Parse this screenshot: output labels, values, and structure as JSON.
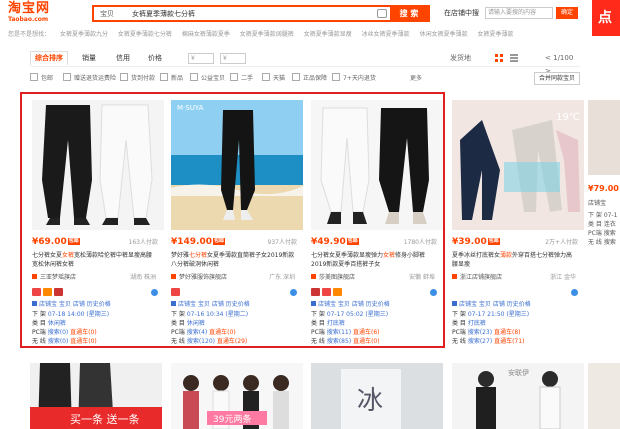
{
  "header": {
    "logo_cn": "淘宝网",
    "logo_en": "Taobao.com",
    "search_scope": "宝贝",
    "search_query": "女裤夏季薄款七分裤",
    "search_button": "搜 索",
    "in_shop_label": "在店铺中搜",
    "in_shop_placeholder": "请输入要搜的内容",
    "confirm_label": "确定",
    "promo_text": "点"
  },
  "suggestions": {
    "prefix": "您是不是想找：",
    "items": [
      "女裤夏季薄款九分",
      "女裤夏季薄款七分裤",
      "棉麻女裤薄款夏季",
      "女裤夏季薄款阔腿裤",
      "女裤夏季薄款显瘦",
      "冰丝女裤夏季薄款",
      "休闲女裤夏季薄款",
      "女裤夏季薄款"
    ]
  },
  "sort_bar": {
    "tabs": [
      "综合排序",
      "销量",
      "信用",
      "价格"
    ],
    "price_from": "¥",
    "price_to": "¥",
    "location": "发货地",
    "page_indicator": "1/100",
    "prev": "<",
    "next": ">"
  },
  "filter_bar": {
    "checkboxes": [
      "包邮",
      "赠送退货运费险",
      "货到付款",
      "新品",
      "公益宝贝",
      "二手",
      "天猫",
      "正品保障",
      "7+天内退货"
    ],
    "more": "更多",
    "merge_button": "合并同款宝贝"
  },
  "products": [
    {
      "price": "¥69.00",
      "badge": "包邮",
      "sold": "163人付款",
      "title_pre": "七分裤女夏",
      "title_hl": "女裤",
      "title_post": "宽松薄款哈伦裤中裤显瘦高腰宽松休闲裤女裤",
      "shop": "三亚梦瑶旗店",
      "city": "湖南 株洲",
      "links": "店铺宝  宝贝  店铺  历史价格",
      "rows": [
        {
          "k": "下 架",
          "v": "07-18 14:00 (星期三)"
        },
        {
          "k": "类 目",
          "v": "休闲裤"
        },
        {
          "k": "PC端",
          "v": "搜索(0)",
          "r": "直通车(0)"
        },
        {
          "k": "无 线",
          "v": "搜索(0)",
          "r": "直通车(0)"
        }
      ]
    },
    {
      "price": "¥149.00",
      "badge": "包邮",
      "sold": "937人付款",
      "title_pre": "梦好雅",
      "title_hl": "七分裤",
      "title_post": "女夏季薄款直筒裤子女2019新款八分裤破洞休闲裤",
      "shop": "梦好雅服饰旗舰店",
      "city": "广东 深圳",
      "links": "店铺宝  宝贝  店铺  历史价格",
      "rows": [
        {
          "k": "下 架",
          "v": "07-16 10:34 (星期二)"
        },
        {
          "k": "类 目",
          "v": "休闲裤"
        },
        {
          "k": "PC端",
          "v": "搜索(4)",
          "r": "直通车(0)"
        },
        {
          "k": "无 线",
          "v": "搜索(120)",
          "r": "直通车(29)"
        }
      ]
    },
    {
      "price": "¥49.90",
      "badge": "包邮",
      "sold": "1780人付款",
      "title_pre": "七分裤女夏季薄款显瘦弹力",
      "title_hl": "女裤",
      "title_post": "修身小脚裤2019新款夏季百搭裤子女",
      "shop": "莎美图旗舰店",
      "city": "安徽 蚌埠",
      "links": "店铺宝  宝贝  店铺  历史价格",
      "rows": [
        {
          "k": "下 架",
          "v": "07-17 05:02 (星期三)"
        },
        {
          "k": "类 目",
          "v": "打底裤"
        },
        {
          "k": "PC端",
          "v": "搜索(11)",
          "r": "直通车(6)"
        },
        {
          "k": "无 线",
          "v": "搜索(85)",
          "r": "直通车(0)"
        }
      ]
    },
    {
      "price": "¥39.00",
      "badge": "包邮",
      "sold": "2万+人付款",
      "title_pre": "夏季冰丝打底裤女",
      "title_hl": "薄款",
      "title_post": "外穿百搭七分裤弹力高腰显瘦",
      "shop": "浙江店铺旗舰店",
      "city": "浙江 金华",
      "links": "店铺宝  宝贝  店铺  历史价格",
      "rows": [
        {
          "k": "下 架",
          "v": "07-17 21:50 (星期三)"
        },
        {
          "k": "类 目",
          "v": "打底裤"
        },
        {
          "k": "PC端",
          "v": "搜索(23)",
          "r": "直通车(8)"
        },
        {
          "k": "无 线",
          "v": "搜索(27)",
          "r": "直通车(71)"
        }
      ]
    }
  ],
  "right_card": {
    "price": "¥79.00",
    "lines": [
      "店铺宝",
      "下 架 07-1",
      "类 目 连衣",
      "PC端 搜索",
      "无 线 搜索"
    ]
  },
  "row2": {
    "banner_text": "买一条 送一条",
    "price_text": "39元两条",
    "brand_text": "冰",
    "card4_label": "安联伊"
  },
  "colors": {
    "accent": "#ff4400",
    "price": "#ff4400",
    "link": "#3a6fd0",
    "highlight_box": "#e02020"
  }
}
